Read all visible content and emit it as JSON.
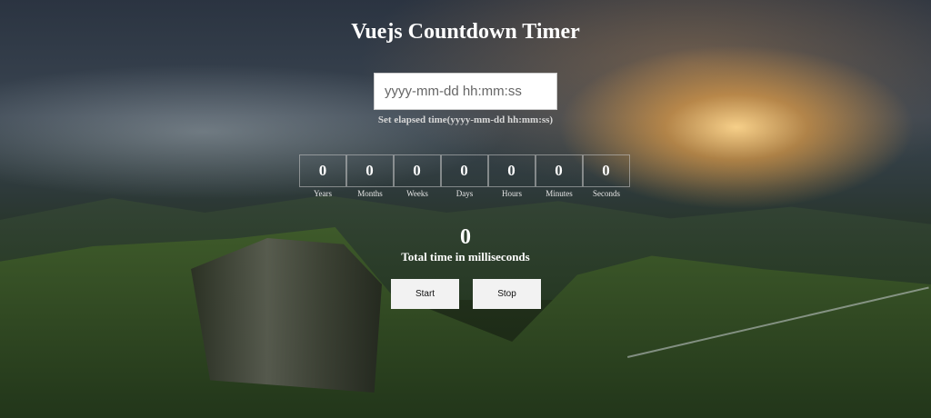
{
  "page": {
    "title": "Vuejs Countdown Timer"
  },
  "input": {
    "placeholder": "yyyy-mm-dd hh:mm:ss",
    "value": "",
    "hint": "Set elapsed time(yyyy-mm-dd hh:mm:ss)"
  },
  "units": [
    {
      "label": "Years",
      "value": "0"
    },
    {
      "label": "Months",
      "value": "0"
    },
    {
      "label": "Weeks",
      "value": "0"
    },
    {
      "label": "Days",
      "value": "0"
    },
    {
      "label": "Hours",
      "value": "0"
    },
    {
      "label": "Minutes",
      "value": "0"
    },
    {
      "label": "Seconds",
      "value": "0"
    }
  ],
  "total": {
    "value": "0",
    "label": "Total time in milliseconds"
  },
  "buttons": {
    "start_label": "Start",
    "stop_label": "Stop"
  }
}
